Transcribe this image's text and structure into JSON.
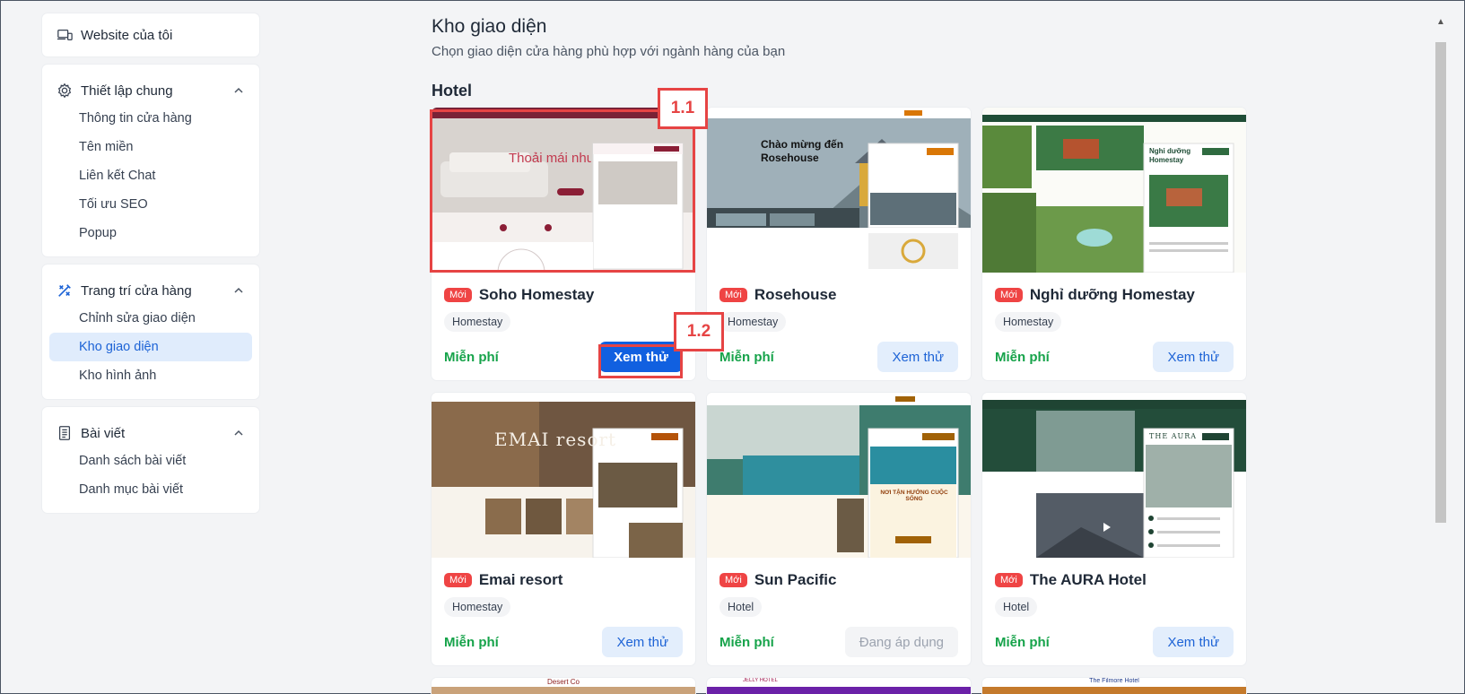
{
  "sidebar": {
    "top_item": "Website của tôi",
    "groups": [
      {
        "title": "Thiết lập chung",
        "items": [
          "Thông tin cửa hàng",
          "Tên miền",
          "Liên kết Chat",
          "Tối ưu SEO",
          "Popup"
        ]
      },
      {
        "title": "Trang trí cửa hàng",
        "items": [
          "Chỉnh sửa giao diện",
          "Kho giao diện",
          "Kho hình ảnh"
        ],
        "active_item": "Kho giao diện"
      },
      {
        "title": "Bài viết",
        "items": [
          "Danh sách bài viết",
          "Danh mục bài viết"
        ]
      }
    ]
  },
  "main": {
    "title": "Kho giao diện",
    "subtitle": "Chọn giao diện cửa hàng phù hợp với ngành hàng của bạn",
    "section": "Hotel",
    "badge_new": "Mới",
    "templates": [
      {
        "name": "Soho Homestay",
        "tag": "Homestay",
        "price": "Miễn phí",
        "action": "Xem thử",
        "thumb_text": "Thoải mái như ở nhà"
      },
      {
        "name": "Rosehouse",
        "tag": "Homestay",
        "price": "Miễn phí",
        "action": "Xem thử",
        "thumb_text": "Chào mừng đến Rosehouse"
      },
      {
        "name": "Nghỉ dưỡng Homestay",
        "tag": "Homestay",
        "price": "Miễn phí",
        "action": "Xem thử",
        "thumb_text": "Nghỉ dưỡng Homestay"
      },
      {
        "name": "Emai resort",
        "tag": "Homestay",
        "price": "Miễn phí",
        "action": "Xem thử",
        "thumb_text": "EMAI resort"
      },
      {
        "name": "Sun Pacific",
        "tag": "Hotel",
        "price": "Miễn phí",
        "action": "Đang áp dụng",
        "thumb_text": "NƠI TẬN HƯỞNG CUỘC SỐNG"
      },
      {
        "name": "The AURA Hotel",
        "tag": "Hotel",
        "price": "Miễn phí",
        "action": "Xem thử",
        "thumb_text": "THE AURA"
      }
    ],
    "row3_thumbs": [
      "Desert Co",
      "JELLY HOTEL",
      "The Filmore Hotel"
    ]
  },
  "callouts": {
    "first": "1.1",
    "second": "1.2"
  },
  "colors": {
    "accent": "#1160e0",
    "free": "#16a34a",
    "new_badge": "#ef4444",
    "highlight": "#e64444"
  }
}
